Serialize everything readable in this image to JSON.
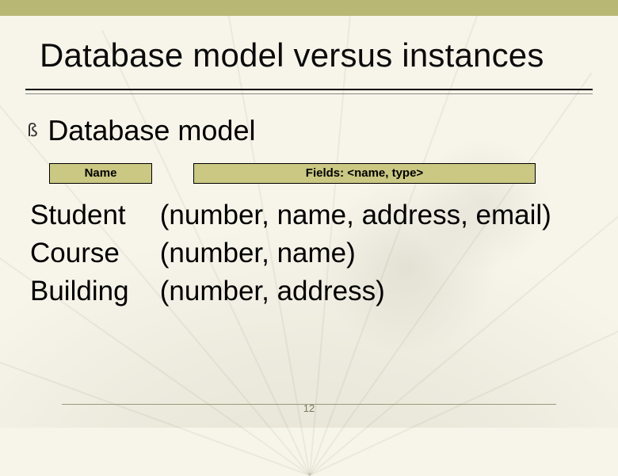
{
  "slide": {
    "title": "Database model versus instances",
    "bullet_arrow": "ß",
    "bullet_text": "Database model",
    "labels": {
      "name": "Name",
      "fields": "Fields: <name, type>"
    },
    "model": [
      {
        "name": "Student",
        "fields": "(number, name, address, email)"
      },
      {
        "name": "Course",
        "fields": "(number, name)"
      },
      {
        "name": "Building",
        "fields": "(number, address)"
      }
    ],
    "page_number": "12"
  }
}
